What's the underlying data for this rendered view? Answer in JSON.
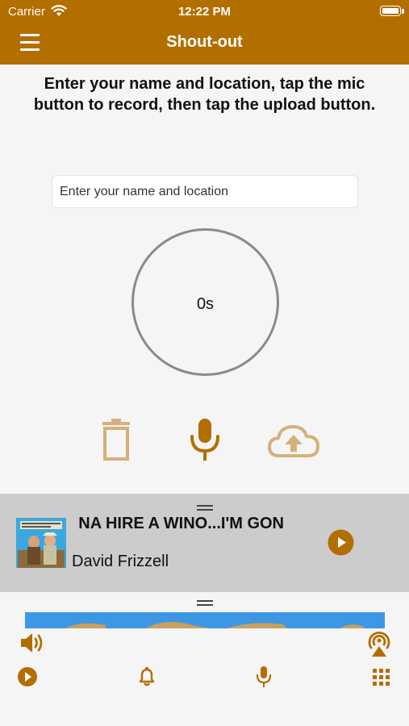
{
  "status_bar": {
    "carrier": "Carrier",
    "time": "12:22 PM"
  },
  "nav": {
    "title": "Shout-out",
    "menu_icon": "hamburger-menu-icon"
  },
  "instructions": "Enter your name and location, tap the mic button to record, then tap the upload button.",
  "name_field": {
    "placeholder": "Enter your name and location",
    "value": ""
  },
  "recording": {
    "elapsed": "0s"
  },
  "actions": {
    "delete_icon": "trash-icon",
    "record_icon": "microphone-icon",
    "upload_icon": "cloud-upload-icon"
  },
  "now_playing": {
    "title_visible": "NA HIRE A WINO...I'M GON",
    "artist": "David Frizzell"
  },
  "tabs": [
    {
      "name": "play",
      "icon": "play-circle-icon"
    },
    {
      "name": "alerts",
      "icon": "bell-icon"
    },
    {
      "name": "shout-out",
      "icon": "microphone-icon"
    },
    {
      "name": "more",
      "icon": "grid-icon"
    }
  ],
  "colors": {
    "accent": "#b36e00",
    "accent_muted": "#d6b07a",
    "player_bg": "#cccccc",
    "page_bg": "#f5f5f5"
  }
}
